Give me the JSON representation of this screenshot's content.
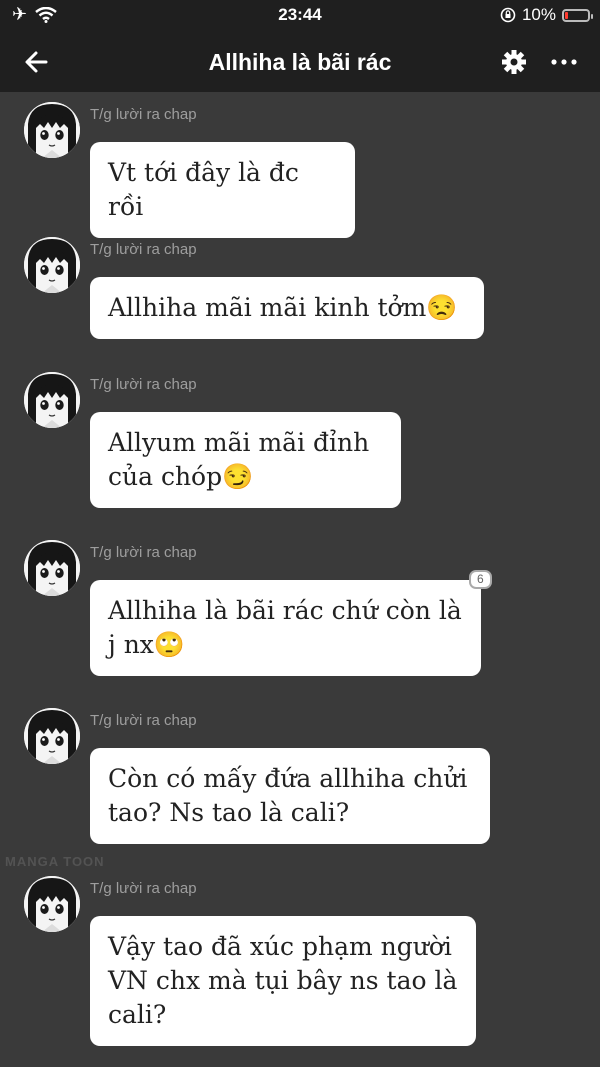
{
  "status_bar": {
    "time": "23:44",
    "battery_percent": "10%",
    "icons": [
      "airplane-icon",
      "wifi-icon",
      "orientation-lock-icon",
      "battery-icon"
    ],
    "battery_color": "#ff3b30"
  },
  "header": {
    "title": "Allhiha là bãi rác",
    "back_icon": "back-arrow-icon",
    "settings_icon": "gear-icon",
    "more_icon": "more-icon"
  },
  "messages": [
    {
      "sender": "T/g lười ra chap",
      "text": [
        "Vt tới đây là đc rồi"
      ]
    },
    {
      "sender": "T/g lười ra chap",
      "text": [
        "Allhiha mãi mãi kinh tởm😒"
      ]
    },
    {
      "sender": "T/g lười ra chap",
      "text": [
        "Allyum mãi mãi đỉnh",
        "của chóp😏"
      ]
    },
    {
      "sender": "T/g lười ra chap",
      "text": [
        "Allhiha là bãi rác chứ còn là",
        "j nx🙄"
      ],
      "badge": "6"
    },
    {
      "sender": "T/g lười ra chap",
      "text": [
        "Còn có mấy đứa allhiha chửi",
        "tao? Ns tao là cali?"
      ]
    },
    {
      "sender": "T/g lười ra chap",
      "text": [
        "Vậy tao đã xúc phạm người",
        "VN chx mà tụi bây ns tao là",
        "cali?"
      ]
    }
  ],
  "watermark": "MANGA TOON",
  "colors": {
    "background": "#3a3a3a",
    "header": "#1f1f1f",
    "bubble": "#ffffff",
    "sender": "#9e9e9e"
  }
}
